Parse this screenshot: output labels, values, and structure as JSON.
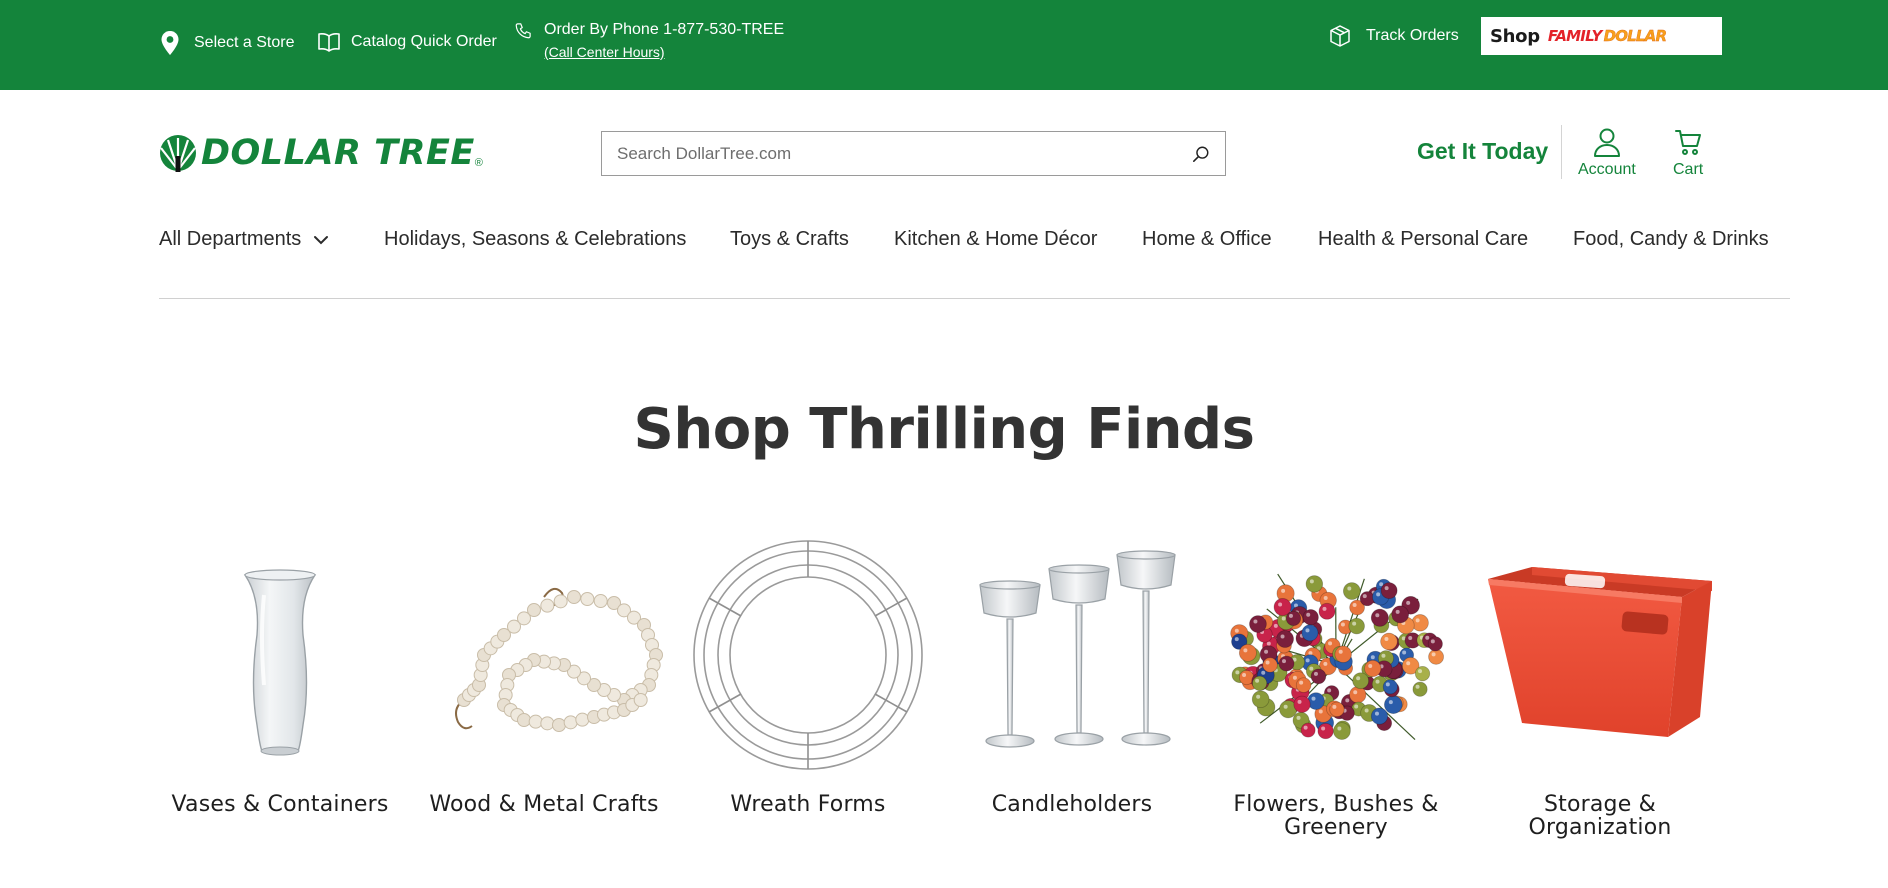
{
  "topbar": {
    "store": {
      "label": "Select a Store",
      "icon": "map-pin-icon"
    },
    "catalog": {
      "label": "Catalog Quick Order",
      "icon": "book-icon"
    },
    "phone": {
      "label": "Order By Phone 1-877-530-TREE",
      "hours_link": "(Call Center Hours)",
      "icon": "phone-icon"
    },
    "track": {
      "label": "Track Orders",
      "icon": "package-icon"
    },
    "family_dollar": {
      "shop": "Shop",
      "brand_part1": "FAMILY",
      "brand_part2": "DOLLAR"
    },
    "bg_color": "#14843b"
  },
  "header": {
    "logo_text": "DOLLAR TREE",
    "logo_reg": "®",
    "search_placeholder": "Search DollarTree.com",
    "get_it_today": "Get It Today",
    "account_label": "Account",
    "cart_label": "Cart",
    "brand_color": "#14843b"
  },
  "nav": {
    "items": [
      {
        "label": "All Departments",
        "has_dropdown": true
      },
      {
        "label": "Holidays, Seasons & Celebrations"
      },
      {
        "label": "Toys & Crafts"
      },
      {
        "label": "Kitchen & Home Décor"
      },
      {
        "label": "Home & Office"
      },
      {
        "label": "Health & Personal Care"
      },
      {
        "label": "Food, Candy & Drinks"
      }
    ]
  },
  "main": {
    "heading": "Shop Thrilling Finds",
    "categories": [
      {
        "label": "Vases & Containers",
        "icon": "vase-image"
      },
      {
        "label": "Wood & Metal Crafts",
        "icon": "wood-bead-garland-image"
      },
      {
        "label": "Wreath Forms",
        "icon": "wire-wreath-image"
      },
      {
        "label": "Candleholders",
        "icon": "candleholders-image"
      },
      {
        "label": "Flowers, Bushes & Greenery",
        "icon": "berry-bush-image"
      },
      {
        "label": "Storage & Organization",
        "icon": "storage-bin-image"
      }
    ]
  }
}
